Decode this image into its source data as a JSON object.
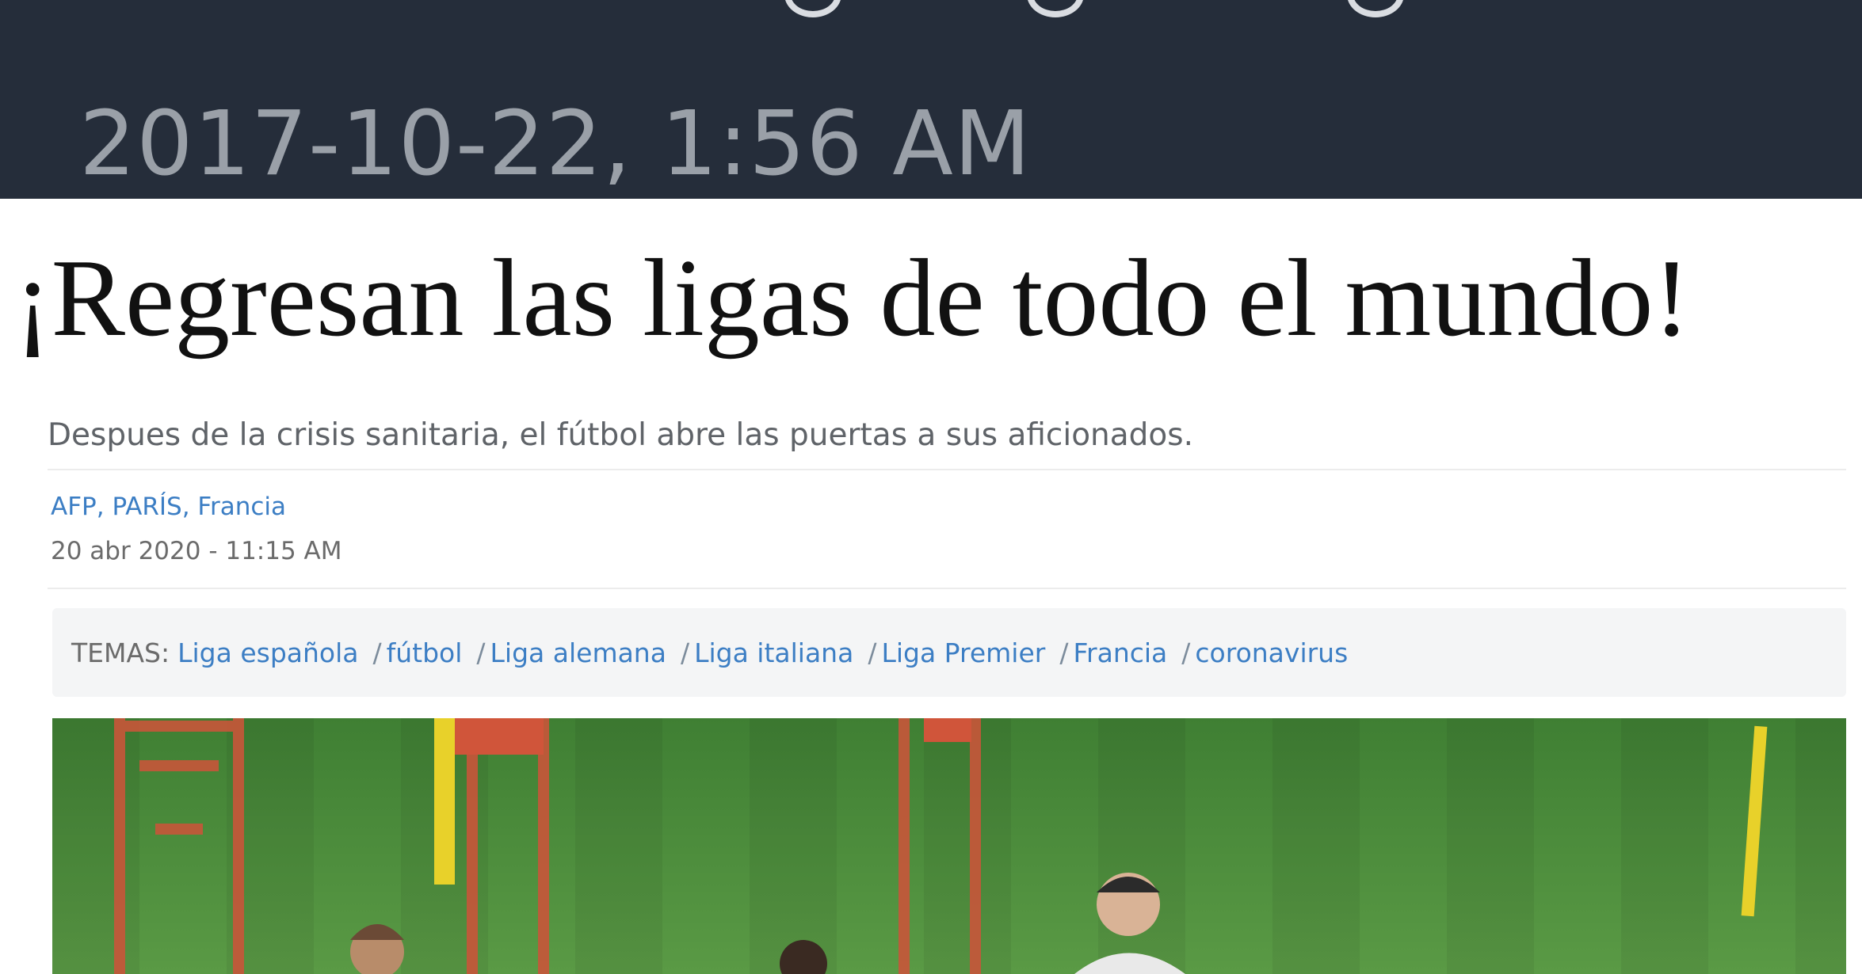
{
  "banner": {
    "timestamp": "2017-10-22, 1:56 AM"
  },
  "article": {
    "headline": "¡Regresan las ligas de todo el mundo!",
    "subtitle": "Despues de la crisis sanitaria, el fútbol abre las puertas a sus aficionados.",
    "byline": "AFP, PARÍS, Francia",
    "date": "20 abr 2020 - 11:15 AM",
    "topics_label": "TEMAS:",
    "topics": [
      "Liga española",
      "fútbol",
      "Liga alemana",
      "Liga italiana",
      "Liga Premier",
      "Francia",
      "coronavirus"
    ],
    "topic_separator": "/"
  },
  "colors": {
    "banner_bg": "#252d3a",
    "link": "#3c7ec4",
    "pitch": "#4a8a3a"
  }
}
